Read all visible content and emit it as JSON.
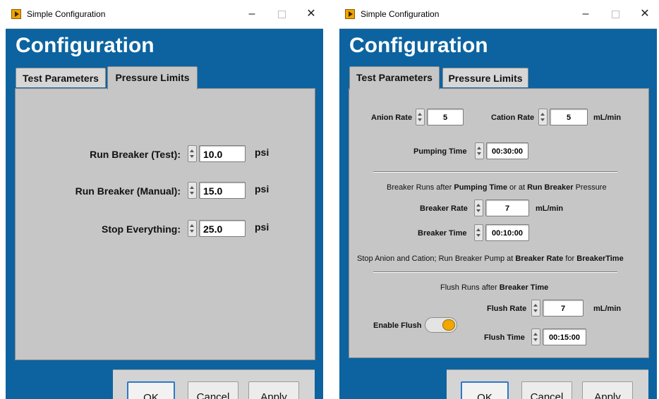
{
  "left": {
    "window_title": "Simple Configuration",
    "heading": "Configuration",
    "tabs": [
      "Test Parameters",
      "Pressure Limits"
    ],
    "active_tab": "Pressure Limits",
    "fields": [
      {
        "label": "Run Breaker (Test):",
        "value": "10.0",
        "unit": "psi"
      },
      {
        "label": "Run Breaker (Manual):",
        "value": "15.0",
        "unit": "psi"
      },
      {
        "label": "Stop Everything:",
        "value": "25.0",
        "unit": "psi"
      }
    ],
    "buttons": {
      "ok": "OK",
      "cancel": "Cancel",
      "apply": "Apply"
    }
  },
  "right": {
    "window_title": "Simple Configuration",
    "heading": "Configuration",
    "tabs": [
      "Test Parameters",
      "Pressure Limits"
    ],
    "active_tab": "Test Parameters",
    "anion_rate": {
      "label": "Anion Rate",
      "value": "5"
    },
    "cation_rate": {
      "label": "Cation Rate",
      "value": "5",
      "unit": "mL/min"
    },
    "pumping_time": {
      "label": "Pumping Time",
      "value": "00:30:00"
    },
    "breaker_note": {
      "p1": "Breaker Runs after ",
      "b1": "Pumping Time",
      "p2": " or at ",
      "b2": "Run Breaker",
      "p3": " Pressure"
    },
    "breaker_rate": {
      "label": "Breaker Rate",
      "value": "7",
      "unit": "mL/min"
    },
    "breaker_time": {
      "label": "Breaker Time",
      "value": "00:10:00"
    },
    "stop_note": {
      "p1": "Stop Anion and Cation; Run Breaker Pump at ",
      "b1": "Breaker Rate",
      "p2": " for ",
      "b2": "BreakerTime"
    },
    "flush_note": {
      "p1": "Flush Runs after ",
      "b1": "Breaker Time"
    },
    "enable_flush": {
      "label": "Enable Flush",
      "state": "on"
    },
    "flush_rate": {
      "label": "Flush Rate",
      "value": "7",
      "unit": "mL/min"
    },
    "flush_time": {
      "label": "Flush Time",
      "value": "00:15:00"
    },
    "buttons": {
      "ok": "OK",
      "cancel": "Cancel",
      "apply": "Apply"
    }
  },
  "icons": {
    "app": "labview-run-icon",
    "minimize": "minimize-icon",
    "maximize": "maximize-icon",
    "close": "close-icon"
  }
}
